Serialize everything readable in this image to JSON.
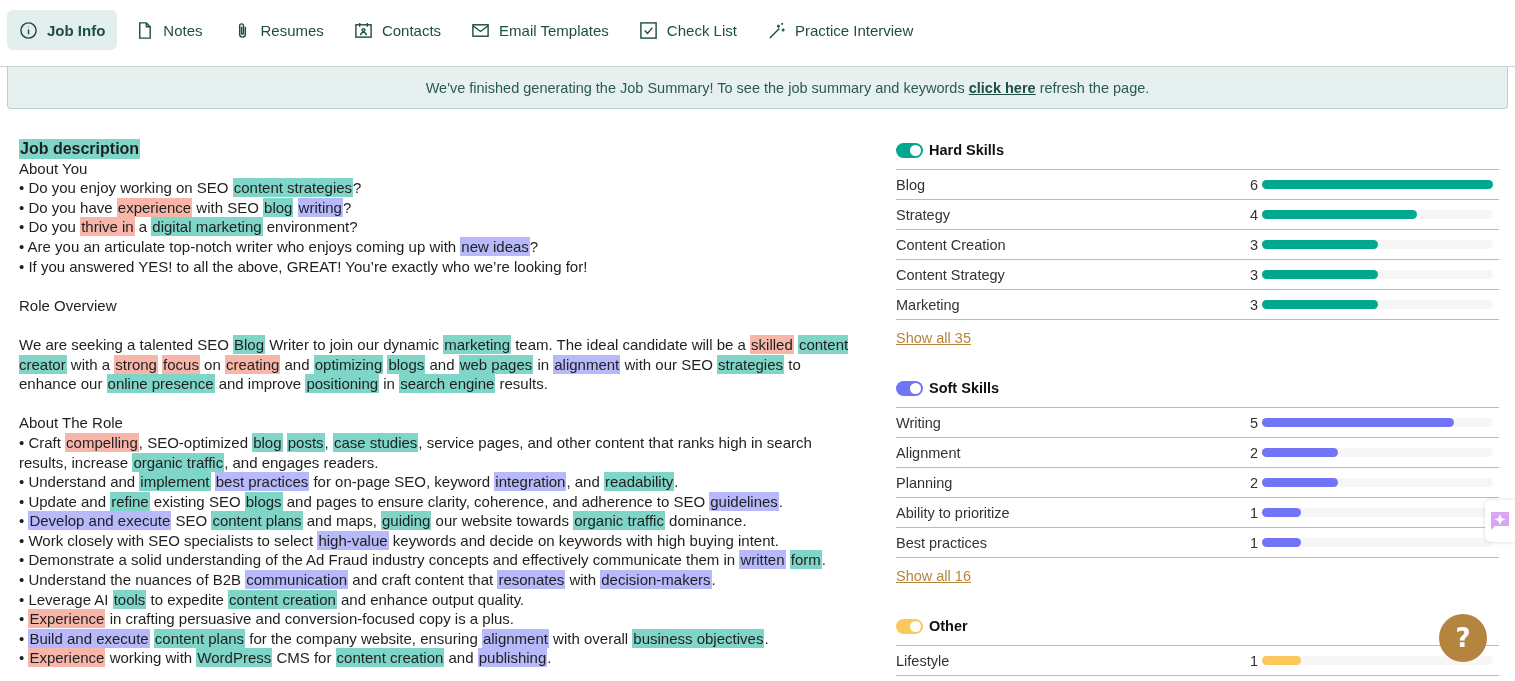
{
  "tabs": [
    {
      "label": "Job Info",
      "selected": true
    },
    {
      "label": "Notes",
      "selected": false
    },
    {
      "label": "Resumes",
      "selected": false
    },
    {
      "label": "Contacts",
      "selected": false
    },
    {
      "label": "Email Templates",
      "selected": false
    },
    {
      "label": "Check List",
      "selected": false
    },
    {
      "label": "Practice Interview",
      "selected": false
    }
  ],
  "banner": {
    "text_before": "We've finished generating the Job Summary! To see the job summary and keywords ",
    "link": "click here",
    "text_after": " refresh the page."
  },
  "description": {
    "title": "Job description",
    "paragraphs": [
      [
        [
          {
            "text": "About You"
          }
        ],
        [
          {
            "text": "• Do you enjoy working on SEO "
          },
          {
            "text": "content strategies",
            "kind": "hard"
          },
          {
            "text": "?"
          }
        ],
        [
          {
            "text": "• Do you have "
          },
          {
            "text": "experience",
            "kind": "trait"
          },
          {
            "text": " with SEO "
          },
          {
            "text": "blog ",
            "kind": "hard"
          },
          {
            "text": "writing",
            "kind": "soft"
          },
          {
            "text": "?"
          }
        ],
        [
          {
            "text": "• Do you "
          },
          {
            "text": "thrive in",
            "kind": "trait"
          },
          {
            "text": " a "
          },
          {
            "text": "digital marketing",
            "kind": "hard"
          },
          {
            "text": " environment?"
          }
        ],
        [
          {
            "text": "• Are you an articulate top-notch writer who enjoys coming up with "
          },
          {
            "text": "new ideas",
            "kind": "soft"
          },
          {
            "text": "?"
          }
        ],
        [
          {
            "text": "• If you answered YES! to all the above, GREAT! You’re exactly who we’re looking for!"
          }
        ]
      ],
      [
        [
          {
            "text": "Role Overview"
          }
        ]
      ],
      [
        [
          {
            "text": "We are seeking a talented SEO "
          },
          {
            "text": "Blog",
            "kind": "hard"
          },
          {
            "text": " Writer to join our dynamic "
          },
          {
            "text": "marketing",
            "kind": "hard"
          },
          {
            "text": " team. The ideal candidate will be a "
          },
          {
            "text": "skilled ",
            "kind": "trait"
          },
          {
            "text": "content creator",
            "kind": "hard"
          },
          {
            "text": " with a "
          },
          {
            "text": "strong ",
            "kind": "trait"
          },
          {
            "text": "focus",
            "kind": "trait"
          },
          {
            "text": " on "
          },
          {
            "text": "creating",
            "kind": "trait"
          },
          {
            "text": " and "
          },
          {
            "text": "optimizing ",
            "kind": "hard"
          },
          {
            "text": "blogs",
            "kind": "hard"
          },
          {
            "text": " and "
          },
          {
            "text": "web pages",
            "kind": "hard"
          },
          {
            "text": " in "
          },
          {
            "text": "alignment",
            "kind": "soft"
          },
          {
            "text": " with our SEO "
          },
          {
            "text": "strategies",
            "kind": "hard"
          },
          {
            "text": " to enhance our "
          },
          {
            "text": "online presence",
            "kind": "hard"
          },
          {
            "text": " and improve "
          },
          {
            "text": "positioning",
            "kind": "hard"
          },
          {
            "text": " in "
          },
          {
            "text": "search engine",
            "kind": "hard"
          },
          {
            "text": " results."
          }
        ]
      ],
      [
        [
          {
            "text": "About The Role"
          }
        ],
        [
          {
            "text": "• Craft "
          },
          {
            "text": "compelling",
            "kind": "trait"
          },
          {
            "text": ", SEO-optimized "
          },
          {
            "text": "blog ",
            "kind": "hard"
          },
          {
            "text": "posts",
            "kind": "hard"
          },
          {
            "text": ", "
          },
          {
            "text": "case studies",
            "kind": "hard"
          },
          {
            "text": ", service pages, and other content that ranks high in search results, increase "
          },
          {
            "text": "organic traffic",
            "kind": "hard"
          },
          {
            "text": ", and engages readers."
          }
        ],
        [
          {
            "text": "• Understand and "
          },
          {
            "text": "implement ",
            "kind": "hard"
          },
          {
            "text": "best practices",
            "kind": "soft"
          },
          {
            "text": " for on-page SEO, keyword "
          },
          {
            "text": "integration",
            "kind": "soft"
          },
          {
            "text": ", and "
          },
          {
            "text": "readability",
            "kind": "hard"
          },
          {
            "text": "."
          }
        ],
        [
          {
            "text": "• Update and "
          },
          {
            "text": "refine",
            "kind": "hard"
          },
          {
            "text": " existing SEO "
          },
          {
            "text": "blogs",
            "kind": "hard"
          },
          {
            "text": " and pages to ensure clarity, coherence, and adherence to SEO "
          },
          {
            "text": "guidelines",
            "kind": "soft"
          },
          {
            "text": "."
          }
        ],
        [
          {
            "text": "• "
          },
          {
            "text": "Develop and execute",
            "kind": "soft"
          },
          {
            "text": " SEO "
          },
          {
            "text": "content plans",
            "kind": "hard"
          },
          {
            "text": " and maps, "
          },
          {
            "text": "guiding",
            "kind": "hard"
          },
          {
            "text": " our website towards "
          },
          {
            "text": "organic traffic",
            "kind": "hard"
          },
          {
            "text": " dominance."
          }
        ],
        [
          {
            "text": "• Work closely with SEO specialists to select "
          },
          {
            "text": "high-value",
            "kind": "soft"
          },
          {
            "text": " keywords and decide on keywords with high buying intent."
          }
        ],
        [
          {
            "text": "• Demonstrate a solid understanding of the Ad Fraud industry concepts and effectively communicate them in "
          },
          {
            "text": "written ",
            "kind": "soft"
          },
          {
            "text": "form",
            "kind": "hard"
          },
          {
            "text": "."
          }
        ],
        [
          {
            "text": "• Understand the nuances of B2B "
          },
          {
            "text": "communication",
            "kind": "soft"
          },
          {
            "text": " and craft content that "
          },
          {
            "text": "resonates",
            "kind": "soft"
          },
          {
            "text": " with "
          },
          {
            "text": "decision-makers",
            "kind": "soft"
          },
          {
            "text": "."
          }
        ],
        [
          {
            "text": "• Leverage AI "
          },
          {
            "text": "tools",
            "kind": "hard"
          },
          {
            "text": " to expedite "
          },
          {
            "text": "content creation",
            "kind": "hard"
          },
          {
            "text": " and enhance output quality."
          }
        ],
        [
          {
            "text": "• "
          },
          {
            "text": "Experience",
            "kind": "trait"
          },
          {
            "text": " in crafting persuasive and conversion-focused copy is a plus."
          }
        ],
        [
          {
            "text": "• "
          },
          {
            "text": "Build and execute ",
            "kind": "soft"
          },
          {
            "text": "content plans",
            "kind": "hard"
          },
          {
            "text": " for the company website, ensuring "
          },
          {
            "text": "alignment",
            "kind": "soft"
          },
          {
            "text": " with overall "
          },
          {
            "text": "business objectives",
            "kind": "hard"
          },
          {
            "text": "."
          }
        ],
        [
          {
            "text": "• "
          },
          {
            "text": "Experience",
            "kind": "trait"
          },
          {
            "text": " working with "
          },
          {
            "text": "WordPress",
            "kind": "hard"
          },
          {
            "text": " CMS for "
          },
          {
            "text": "content creation",
            "kind": "hard"
          },
          {
            "text": " and "
          },
          {
            "text": "publishing",
            "kind": "soft"
          },
          {
            "text": "."
          }
        ]
      ]
    ]
  },
  "skill_groups": [
    {
      "title": "Hard Skills",
      "on": true,
      "color": "#00a88f",
      "show_all": "Show all 35",
      "skills": [
        {
          "name": "Blog",
          "count": "6",
          "level": 1
        },
        {
          "name": "Strategy",
          "count": "4",
          "level": 0.67
        },
        {
          "name": "Content Creation",
          "count": "3",
          "level": 0.5
        },
        {
          "name": "Content Strategy",
          "count": "3",
          "level": 0.5
        },
        {
          "name": "Marketing",
          "count": "3",
          "level": 0.5
        }
      ]
    },
    {
      "title": "Soft Skills",
      "on": true,
      "color": "#7074f5",
      "show_all": "Show all 16",
      "skills": [
        {
          "name": "Writing",
          "count": "5",
          "level": 0.83
        },
        {
          "name": "Alignment",
          "count": "2",
          "level": 0.33
        },
        {
          "name": "Planning",
          "count": "2",
          "level": 0.33
        },
        {
          "name": "Ability to prioritize",
          "count": "1",
          "level": 0.17
        },
        {
          "name": "Best practices",
          "count": "1",
          "level": 0.17
        }
      ]
    },
    {
      "title": "Other",
      "on": true,
      "color": "#fcc85c",
      "skills": [
        {
          "name": "Lifestyle",
          "count": "1",
          "level": 0.17
        }
      ]
    }
  ],
  "help_button": {
    "label": "?"
  }
}
